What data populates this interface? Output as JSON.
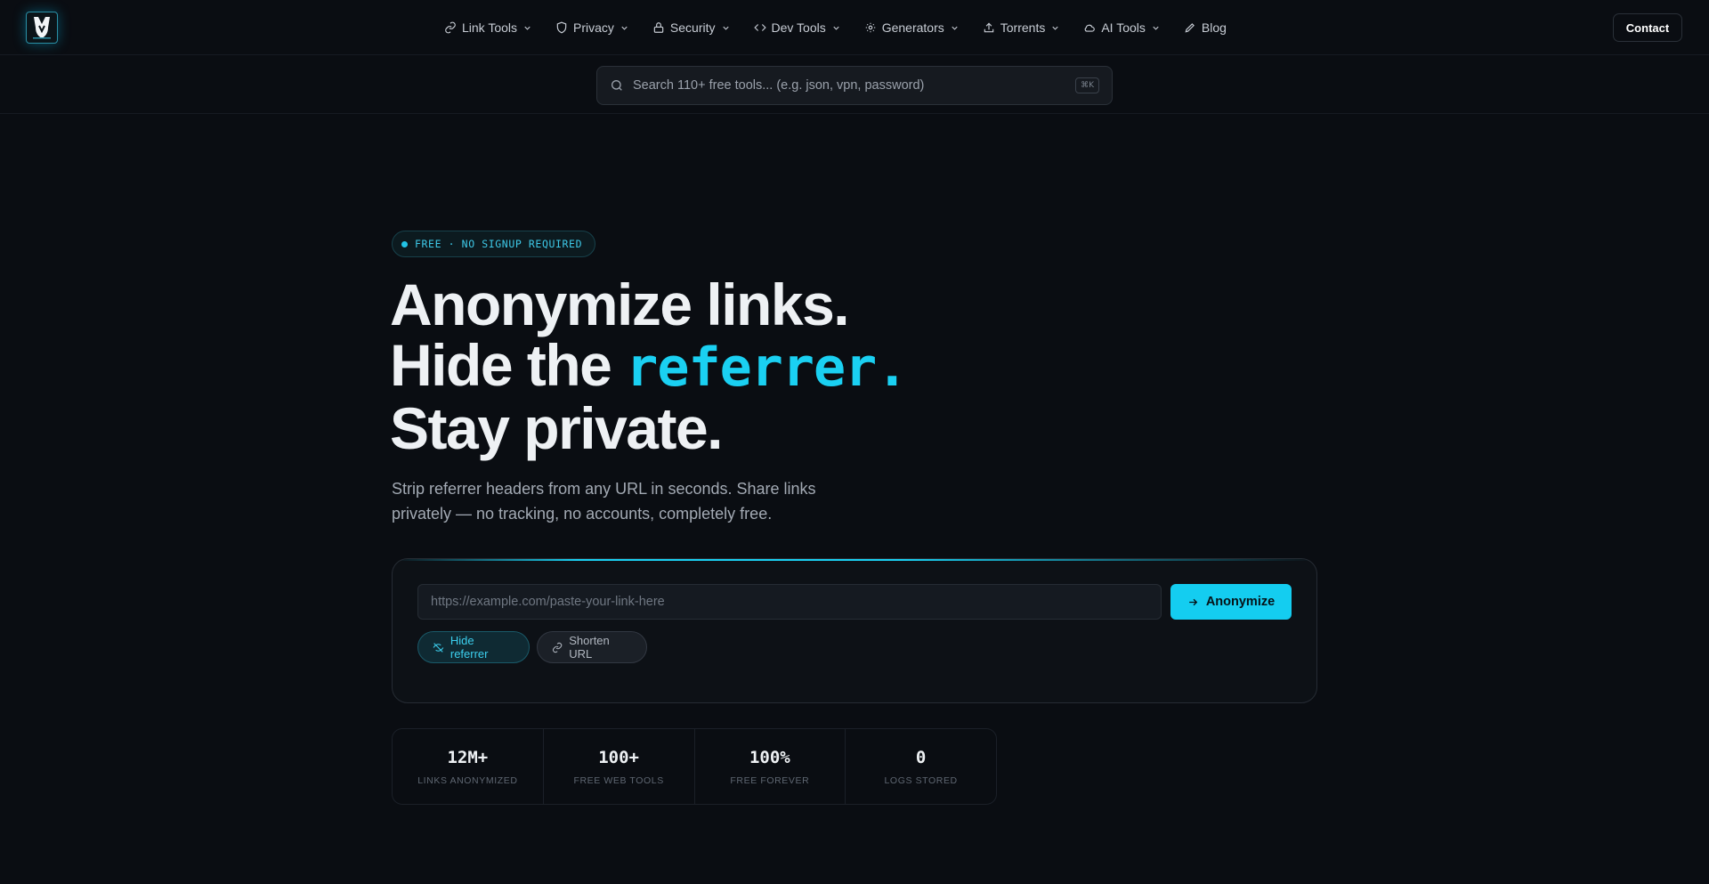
{
  "nav": {
    "items": [
      {
        "label": "Link Tools",
        "icon": "link-icon",
        "has_dropdown": true
      },
      {
        "label": "Privacy",
        "icon": "shield-icon",
        "has_dropdown": true
      },
      {
        "label": "Security",
        "icon": "lock-icon",
        "has_dropdown": true
      },
      {
        "label": "Dev Tools",
        "icon": "code-icon",
        "has_dropdown": true
      },
      {
        "label": "Generators",
        "icon": "sun-icon",
        "has_dropdown": true
      },
      {
        "label": "Torrents",
        "icon": "upload-icon",
        "has_dropdown": true
      },
      {
        "label": "AI Tools",
        "icon": "cloud-icon",
        "has_dropdown": true
      },
      {
        "label": "Blog",
        "icon": "pen-icon",
        "has_dropdown": false
      }
    ],
    "contact_label": "Contact"
  },
  "search": {
    "placeholder": "Search 110+ free tools... (e.g. json, vpn, password)",
    "shortcut": "⌘K"
  },
  "hero": {
    "badge": "FREE · NO SIGNUP REQUIRED",
    "line1": "Anonymize links.",
    "line2_prefix": "Hide the ",
    "line2_highlight": "referrer.",
    "line3": "Stay private.",
    "subtitle_line1": "Strip referrer headers from any URL in seconds. Share links",
    "subtitle_line2": "privately — no tracking, no accounts, completely free."
  },
  "form": {
    "url_placeholder": "https://example.com/paste-your-link-here",
    "submit_label": "Anonymize",
    "options": [
      {
        "label": "Hide referrer",
        "icon": "eye-off-icon",
        "active": true
      },
      {
        "label": "Shorten URL",
        "icon": "link-icon",
        "active": false
      }
    ]
  },
  "stats": [
    {
      "value": "12M+",
      "label": "LINKS ANONYMIZED"
    },
    {
      "value": "100+",
      "label": "FREE WEB TOOLS"
    },
    {
      "value": "100%",
      "label": "FREE FOREVER"
    },
    {
      "value": "0",
      "label": "LOGS STORED"
    }
  ],
  "colors": {
    "background": "#0a0d12",
    "accent": "#14cdf0",
    "text_primary": "#eef1f4",
    "text_muted": "#a3aab4"
  }
}
